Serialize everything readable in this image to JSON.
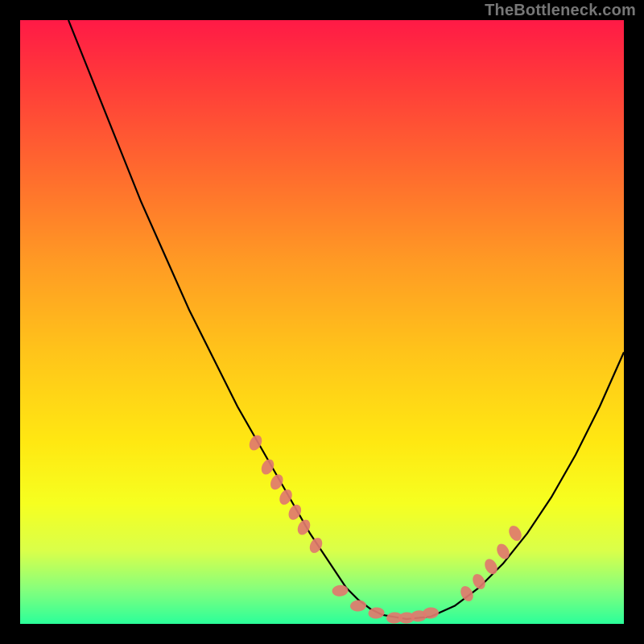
{
  "watermark": "TheBottleneck.com",
  "chart_data": {
    "type": "line",
    "title": "",
    "xlabel": "",
    "ylabel": "",
    "xlim": [
      0,
      100
    ],
    "ylim": [
      0,
      100
    ],
    "annotations": [],
    "series": [
      {
        "name": "curve",
        "color": "#000000",
        "x": [
          8,
          12,
          16,
          20,
          24,
          28,
          32,
          36,
          40,
          44,
          48,
          50,
          52,
          54,
          56,
          58,
          60,
          64,
          68,
          72,
          76,
          80,
          84,
          88,
          92,
          96,
          100
        ],
        "y": [
          100,
          90,
          80,
          70,
          61,
          52,
          44,
          36,
          29,
          22,
          15,
          12,
          9,
          6,
          4,
          2.5,
          1.5,
          0.8,
          1.2,
          3,
          6,
          10,
          15,
          21,
          28,
          36,
          45
        ]
      },
      {
        "name": "markers-left",
        "color": "#e07a6e",
        "x": [
          39,
          41,
          42.5,
          44,
          45.5,
          47,
          49
        ],
        "y": [
          30,
          26,
          23.5,
          21,
          18.5,
          16,
          13
        ]
      },
      {
        "name": "markers-bottom",
        "color": "#e07a6e",
        "x": [
          53,
          56,
          59,
          62,
          64,
          66,
          68
        ],
        "y": [
          5.5,
          3,
          1.8,
          1,
          1,
          1.3,
          1.8
        ]
      },
      {
        "name": "markers-right",
        "color": "#e07a6e",
        "x": [
          74,
          76,
          78,
          80,
          82
        ],
        "y": [
          5,
          7,
          9.5,
          12,
          15
        ]
      }
    ],
    "background_gradient": {
      "top": "#ff1a46",
      "bottom": "#2bff9a"
    }
  }
}
